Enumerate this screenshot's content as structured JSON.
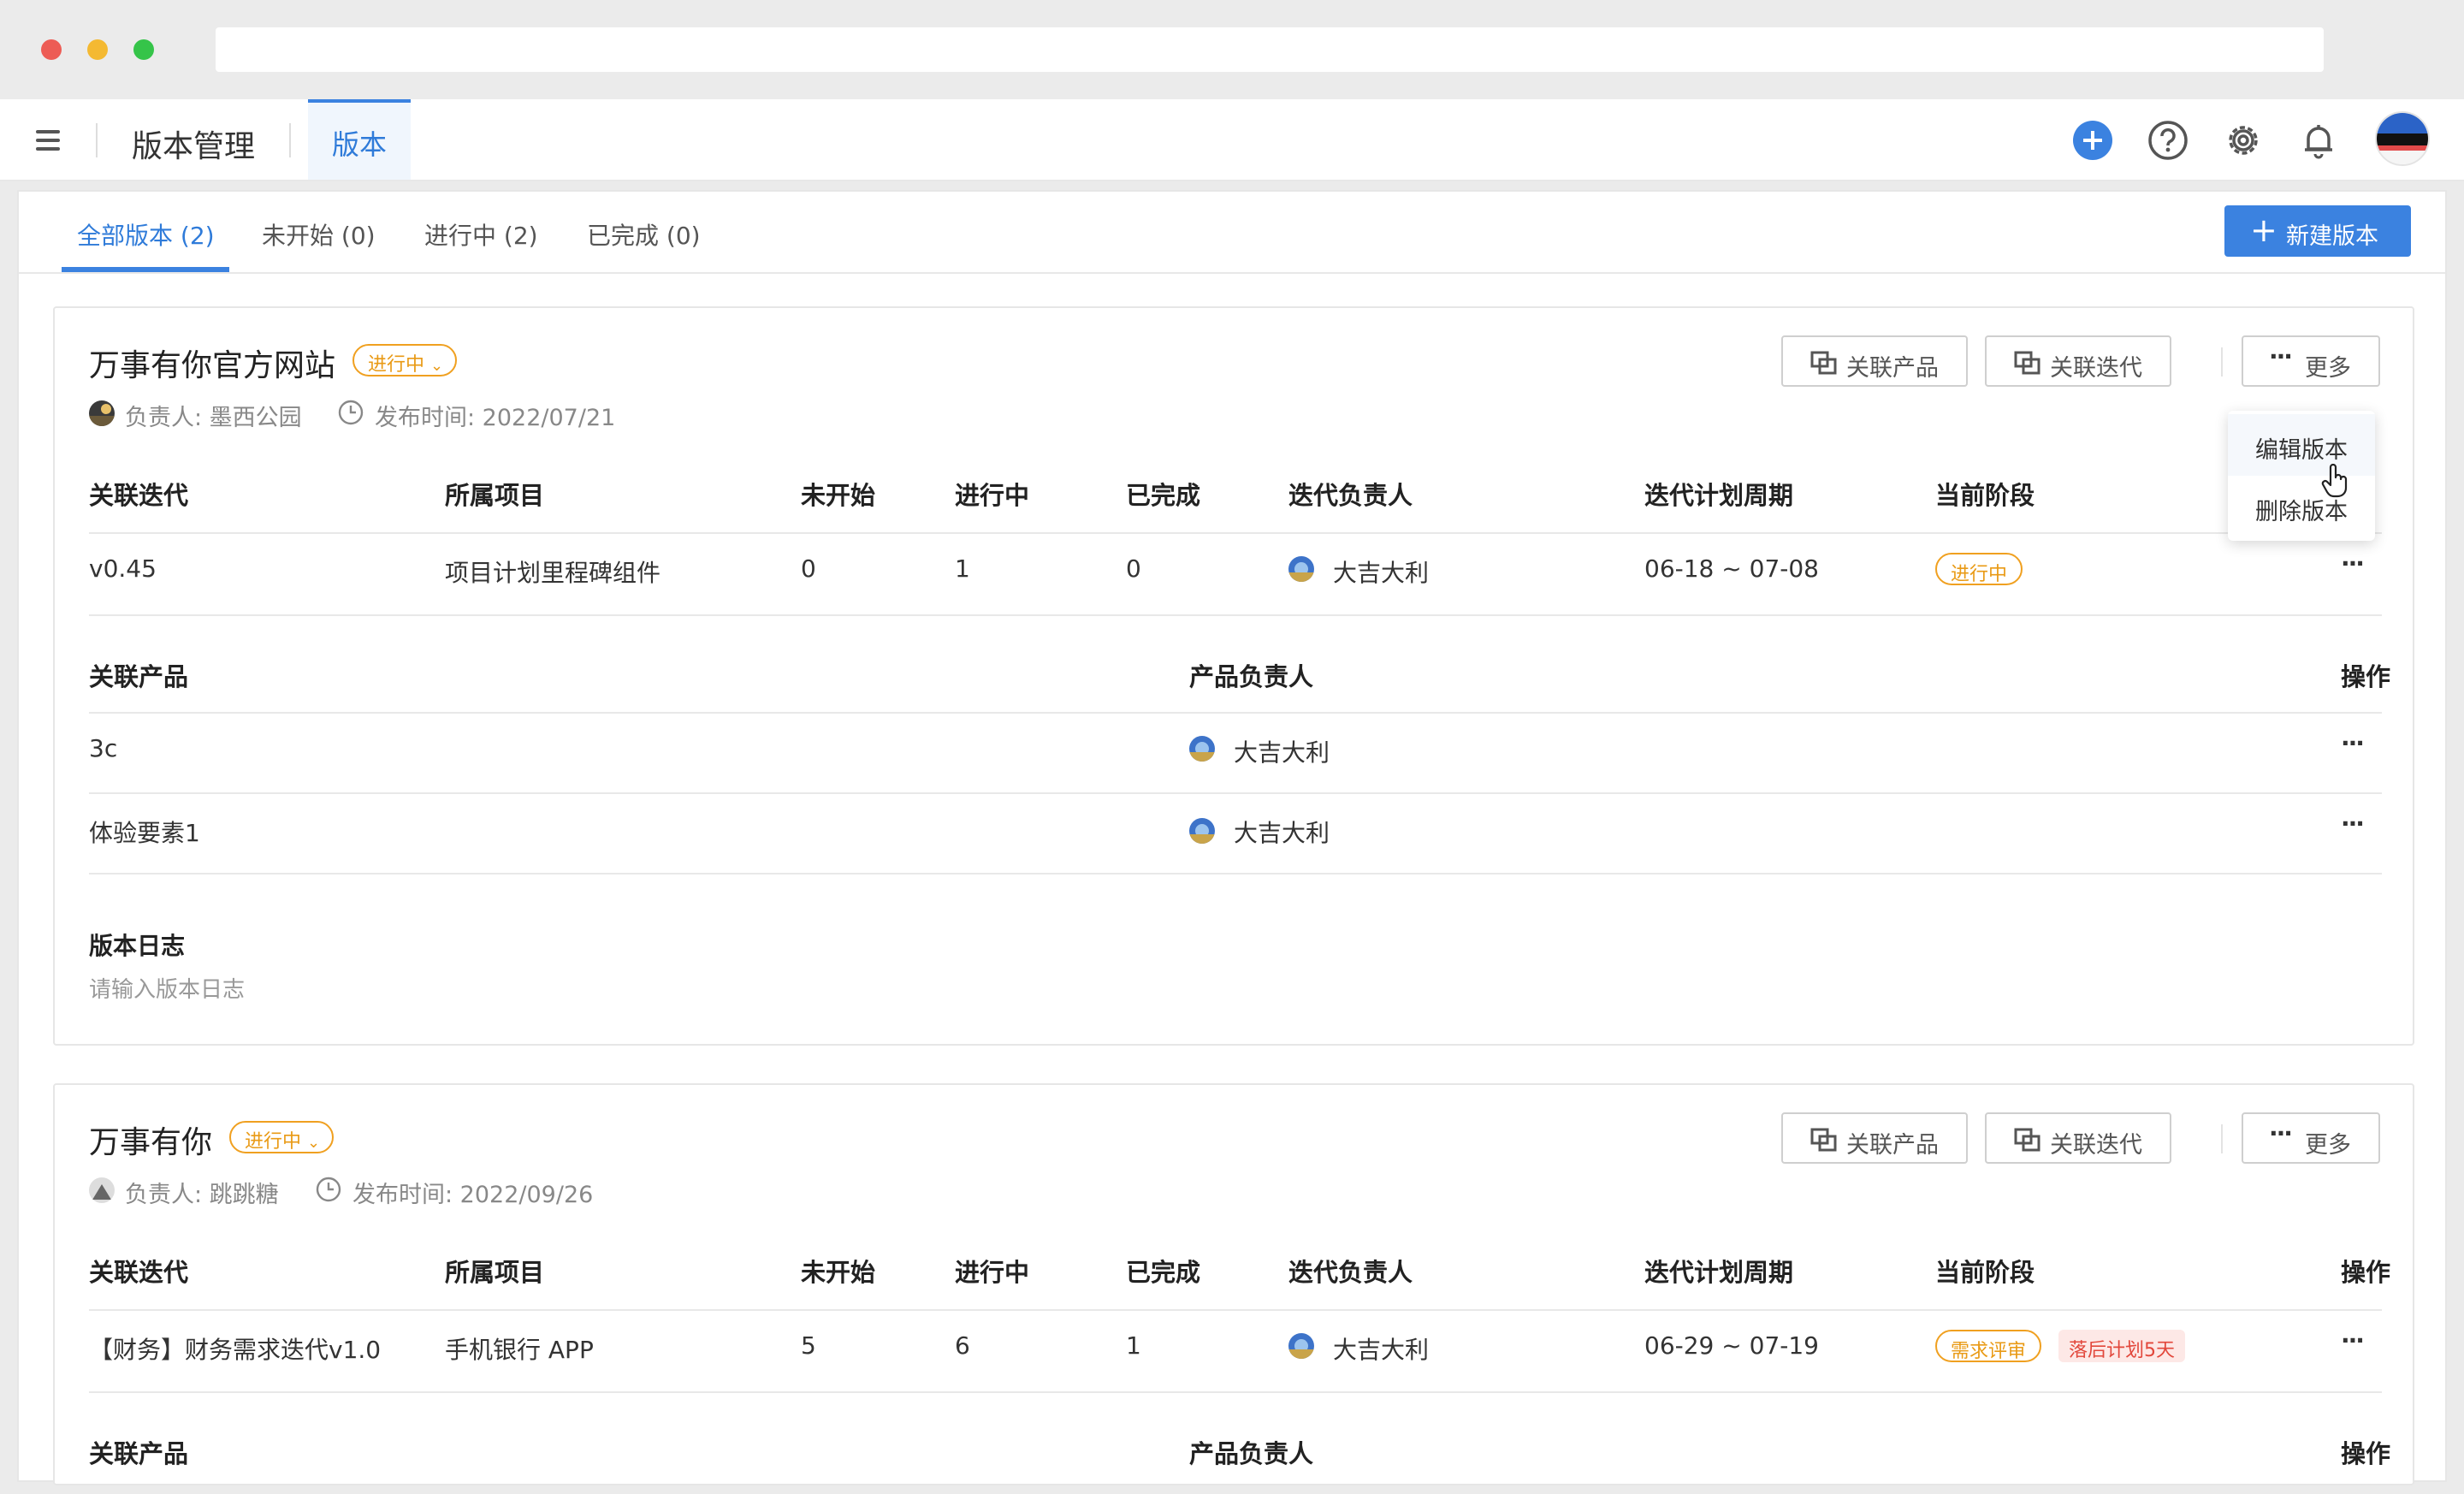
{
  "header": {
    "app_title": "版本管理",
    "active_tab": "版本",
    "icons": [
      "menu-icon",
      "add-icon",
      "help-icon",
      "settings-icon",
      "bell-icon",
      "avatar"
    ]
  },
  "tabs": [
    {
      "label": "全部版本 (2)",
      "active": true
    },
    {
      "label": "未开始 (0)"
    },
    {
      "label": "进行中 (2)"
    },
    {
      "label": "已完成 (0)"
    }
  ],
  "new_button": "新建版本",
  "colors": {
    "primary": "#3b82e0",
    "warning": "#f0a020",
    "danger": "#e2473b"
  },
  "versions": [
    {
      "name": "万事有你官方网站",
      "status": "进行中",
      "owner": "负责人: 墨西公园",
      "release": "发布时间: 2022/07/21",
      "btn_product": "关联产品",
      "btn_iteration": "关联迭代",
      "btn_more": "更多",
      "iteration_headers": [
        "关联迭代",
        "所属项目",
        "未开始",
        "进行中",
        "已完成",
        "迭代负责人",
        "迭代计划周期",
        "当前阶段"
      ],
      "iterations": [
        {
          "name": "v0.45",
          "project": "项目计划里程碑组件",
          "not_started": "0",
          "in_progress": "1",
          "done": "0",
          "owner": "大吉大利",
          "period": "06-18 ~ 07-08",
          "stage": "进行中"
        }
      ],
      "product_headers": [
        "关联产品",
        "产品负责人",
        "操作"
      ],
      "products": [
        {
          "name": "3c",
          "owner": "大吉大利"
        },
        {
          "name": "体验要素1",
          "owner": "大吉大利"
        }
      ],
      "log_label": "版本日志",
      "log_placeholder": "请输入版本日志"
    },
    {
      "name": "万事有你",
      "status": "进行中",
      "owner": "负责人: 跳跳糖",
      "release": "发布时间: 2022/09/26",
      "btn_product": "关联产品",
      "btn_iteration": "关联迭代",
      "btn_more": "更多",
      "iteration_headers": [
        "关联迭代",
        "所属项目",
        "未开始",
        "进行中",
        "已完成",
        "迭代负责人",
        "迭代计划周期",
        "当前阶段",
        "操作"
      ],
      "iterations": [
        {
          "name": "【财务】财务需求迭代v1.0",
          "project": "手机银行 APP",
          "not_started": "5",
          "in_progress": "6",
          "done": "1",
          "owner": "大吉大利",
          "period": "06-29 ~ 07-19",
          "stage": "需求评审",
          "warning": "落后计划5天"
        }
      ],
      "product_headers": [
        "关联产品",
        "产品负责人",
        "操作"
      ]
    }
  ],
  "dropdown": {
    "items": [
      "编辑版本",
      "删除版本"
    ]
  }
}
